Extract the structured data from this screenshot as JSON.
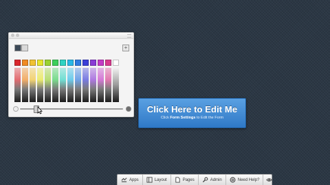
{
  "color_picker": {
    "hue_swatches": [
      "#d9272e",
      "#f08a24",
      "#f1c232",
      "#e6e62e",
      "#9ad233",
      "#3ccf5a",
      "#2fd3c2",
      "#29b7e6",
      "#2f7be0",
      "#3b3fd8",
      "#8a3bd6",
      "#c33cc6",
      "#d83b8f",
      "#ffffff"
    ],
    "current_color": "#3b4856",
    "previous_color": "#d9d9d9",
    "add_swatch_glyph": "+",
    "opacity_level": 0.15
  },
  "edit_banner": {
    "title": "Click Here to Edit Me",
    "subtitle_prefix": "Click ",
    "subtitle_link": "Form Settings",
    "subtitle_suffix": " to Edit the Form"
  },
  "toolbar": {
    "items": [
      {
        "label": "Apps",
        "icon": "apps-icon"
      },
      {
        "label": "Layout",
        "icon": "layout-icon"
      },
      {
        "label": "Pages",
        "icon": "pages-icon"
      },
      {
        "label": "Admin",
        "icon": "admin-icon"
      },
      {
        "label": "Need Help?",
        "icon": "help-icon"
      }
    ],
    "preview_icon": "eye-icon"
  }
}
